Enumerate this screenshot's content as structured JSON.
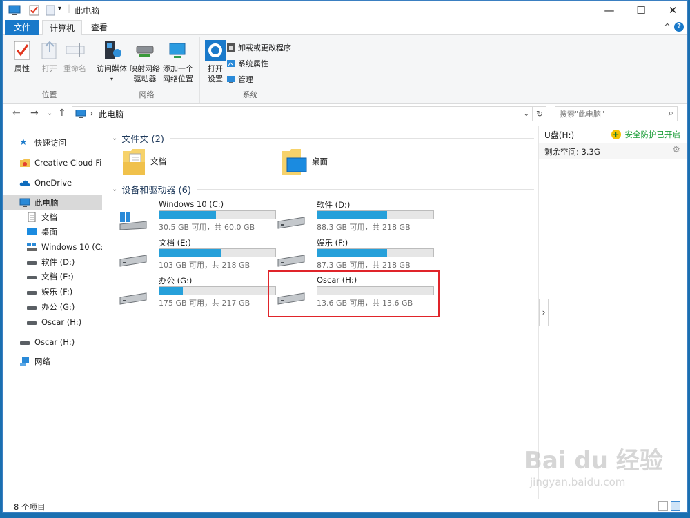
{
  "window": {
    "title": "此电脑",
    "controls": {
      "minimize": "—",
      "maximize": "☐",
      "close": "✕"
    }
  },
  "ribbon": {
    "tabs": [
      {
        "label": "文件"
      },
      {
        "label": "计算机"
      },
      {
        "label": "查看"
      }
    ],
    "help": "?",
    "collapse": "^",
    "groups": [
      {
        "name": "位置",
        "buttons": [
          {
            "label": "属性"
          },
          {
            "label": "打开"
          },
          {
            "label": "重命名"
          }
        ]
      },
      {
        "name": "网络",
        "buttons": [
          {
            "label": "访问媒体"
          },
          {
            "label": "映射网络\n驱动器"
          },
          {
            "label": "添加一个\n网络位置"
          }
        ]
      },
      {
        "name": "系统",
        "buttons": [
          {
            "label": "打开\n设置"
          }
        ],
        "small": [
          {
            "label": "卸载或更改程序"
          },
          {
            "label": "系统属性"
          },
          {
            "label": "管理"
          }
        ]
      }
    ]
  },
  "address": {
    "path": "此电脑",
    "search_placeholder": "搜索\"此电脑\""
  },
  "nav": {
    "items": [
      {
        "label": "快速访问",
        "icon": "star-icon"
      },
      {
        "label": "Creative Cloud Files",
        "icon": "creative-cloud-icon"
      },
      {
        "label": "OneDrive",
        "icon": "cloud-icon"
      },
      {
        "label": "此电脑",
        "icon": "pc-icon"
      },
      {
        "label": "文档",
        "icon": "document-icon"
      },
      {
        "label": "桌面",
        "icon": "desktop-icon"
      },
      {
        "label": "Windows 10 (C:)",
        "icon": "drive-icon"
      },
      {
        "label": "软件 (D:)",
        "icon": "drive-icon"
      },
      {
        "label": "文档 (E:)",
        "icon": "drive-icon"
      },
      {
        "label": "娱乐 (F:)",
        "icon": "drive-icon"
      },
      {
        "label": "办公 (G:)",
        "icon": "drive-icon"
      },
      {
        "label": "Oscar (H:)",
        "icon": "drive-icon"
      },
      {
        "label": "Oscar (H:)",
        "icon": "drive-icon"
      },
      {
        "label": "网络",
        "icon": "network-icon"
      }
    ]
  },
  "content": {
    "folders_header": "文件夹 (2)",
    "folders": [
      {
        "label": "文档"
      },
      {
        "label": "桌面"
      }
    ],
    "drives_header": "设备和驱动器 (6)",
    "drives": [
      {
        "name": "Windows 10 (C:)",
        "free": "30.5 GB 可用，共 60.0 GB",
        "used_fraction": 0.49
      },
      {
        "name": "软件 (D:)",
        "free": "88.3 GB 可用，共 218 GB",
        "used_fraction": 0.6
      },
      {
        "name": "文档 (E:)",
        "free": "103 GB 可用，共 218 GB",
        "used_fraction": 0.53
      },
      {
        "name": "娱乐 (F:)",
        "free": "87.3 GB 可用，共 218 GB",
        "used_fraction": 0.6
      },
      {
        "name": "办公 (G:)",
        "free": "175 GB 可用，共 217 GB",
        "used_fraction": 0.2
      },
      {
        "name": "Oscar (H:)",
        "free": "13.6 GB 可用，共 13.6 GB",
        "used_fraction": 0.0
      }
    ]
  },
  "details": {
    "name": "U盘(H:)",
    "status": "安全防护已开启",
    "free": "剩余空间: 3.3G"
  },
  "status": {
    "items": "8 个项目"
  },
  "watermark": {
    "main": "Bai du 经验",
    "sub": "jingyan.baidu.com"
  },
  "colors": {
    "accent": "#1979ca",
    "bar_fill": "#26a0da",
    "highlight": "#e0242a",
    "safe_green": "#20a03c"
  }
}
